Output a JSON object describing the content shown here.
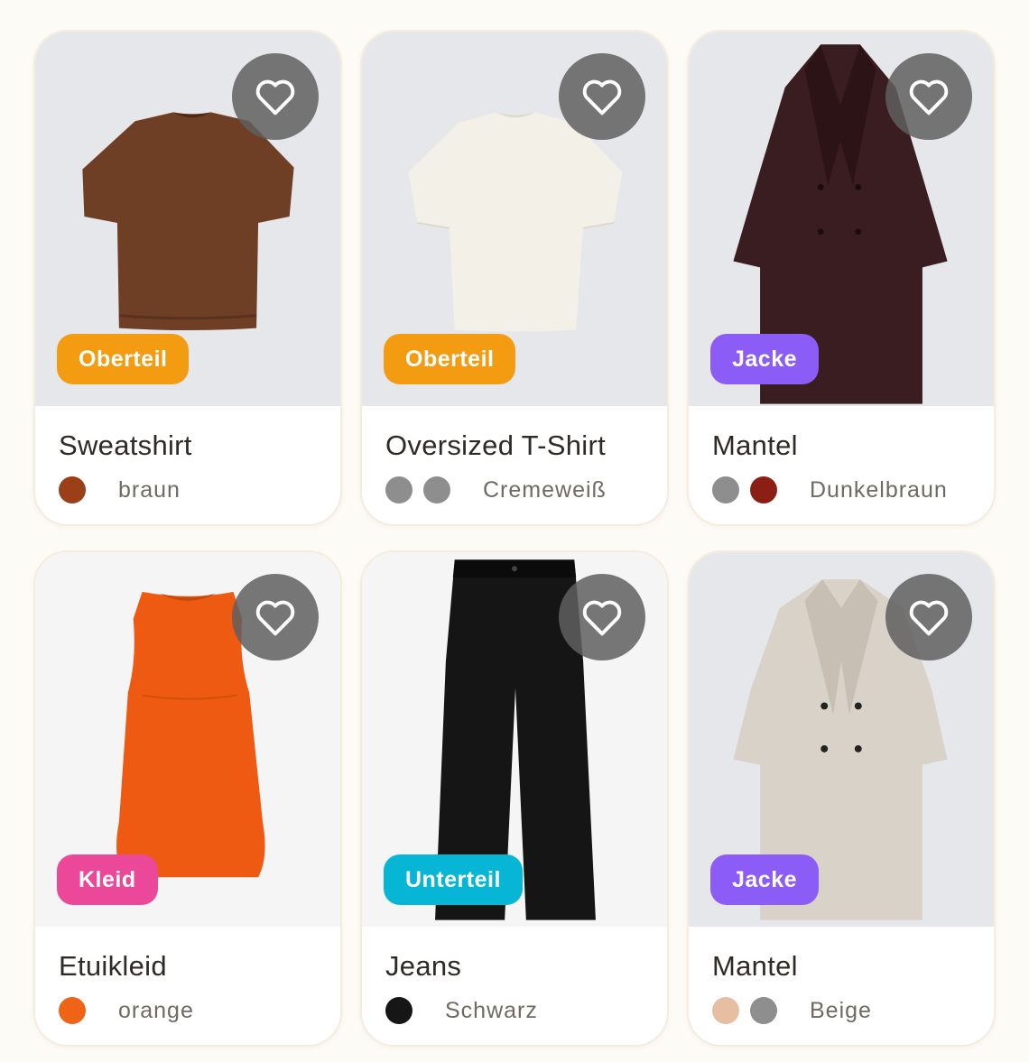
{
  "ui": {
    "favorite_icon": "heart-outline-icon",
    "category_colors": {
      "Oberteil": "#f39c12",
      "Jacke": "#8b5cf6",
      "Kleid": "#ec4899",
      "Unterteil": "#06b6d4"
    }
  },
  "items": [
    {
      "title": "Sweatshirt",
      "category": "Oberteil",
      "category_color": "#f39c12",
      "color_name": "braun",
      "swatches": [
        "#9a3f17"
      ],
      "image_icon": "brown-tshirt-image"
    },
    {
      "title": "Oversized T-Shirt",
      "category": "Oberteil",
      "category_color": "#f39c12",
      "color_name": "Cremeweiß",
      "swatches": [
        "#8e8e8e",
        "#8e8e8e"
      ],
      "image_icon": "cream-tshirt-image"
    },
    {
      "title": "Mantel",
      "category": "Jacke",
      "category_color": "#8b5cf6",
      "color_name": "Dunkelbraun",
      "swatches": [
        "#8e8e8e",
        "#8c1f14"
      ],
      "image_icon": "dark-brown-coat-image"
    },
    {
      "title": "Etuikleid",
      "category": "Kleid",
      "category_color": "#ec4899",
      "color_name": "orange",
      "swatches": [
        "#f06418"
      ],
      "image_icon": "orange-dress-image"
    },
    {
      "title": "Jeans",
      "category": "Unterteil",
      "category_color": "#06b6d4",
      "color_name": "Schwarz",
      "swatches": [
        "#161616"
      ],
      "image_icon": "black-jeans-image"
    },
    {
      "title": "Mantel",
      "category": "Jacke",
      "category_color": "#8b5cf6",
      "color_name": "Beige",
      "swatches": [
        "#e6bfa3",
        "#8e8e8e"
      ],
      "image_icon": "beige-coat-image"
    }
  ]
}
